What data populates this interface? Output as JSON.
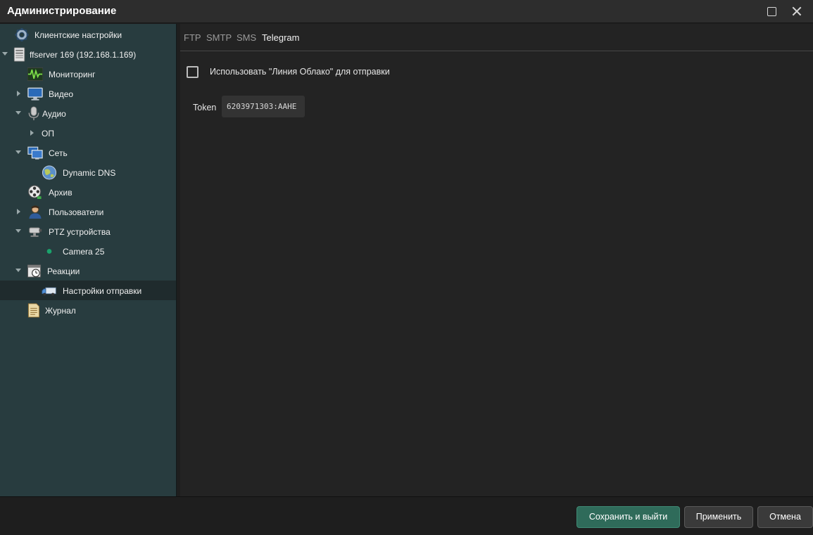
{
  "window": {
    "title": "Администрирование"
  },
  "sidebar": {
    "items": [
      {
        "label": "Клиентские настройки",
        "icon": "gear-icon"
      },
      {
        "label": "ffserver 169 (192.168.1.169)",
        "icon": "server-icon",
        "expanded": true
      },
      {
        "label": "Мониторинг",
        "icon": "monitoring-wave-icon"
      },
      {
        "label": "Видео",
        "icon": "monitor-icon",
        "expanded": false
      },
      {
        "label": "Аудио",
        "icon": "microphone-icon",
        "expanded": true
      },
      {
        "label": "ОП",
        "expanded": false
      },
      {
        "label": "Сеть",
        "icon": "network-icon",
        "expanded": true
      },
      {
        "label": "Dynamic DNS",
        "icon": "globe-icon"
      },
      {
        "label": "Архив",
        "icon": "film-reel-icon"
      },
      {
        "label": "Пользователи",
        "icon": "user-icon",
        "expanded": false
      },
      {
        "label": "PTZ устройства",
        "icon": "ptz-camera-icon",
        "expanded": true
      },
      {
        "label": "Camera 25",
        "icon": "status-dot-icon",
        "status_color": "#1aa36c"
      },
      {
        "label": "Реакции",
        "icon": "calendar-clock-icon",
        "expanded": true
      },
      {
        "label": "Настройки отправки",
        "icon": "delivery-truck-icon",
        "selected": true
      },
      {
        "label": "Журнал",
        "icon": "journal-icon"
      }
    ]
  },
  "tabs": [
    {
      "label": "FTP"
    },
    {
      "label": "SMTP"
    },
    {
      "label": "SMS"
    },
    {
      "label": "Telegram",
      "active": true
    }
  ],
  "form": {
    "use_cloud_label": "Использовать \"Линия Облако\" для отправки",
    "use_cloud_checked": false,
    "token_label": "Token",
    "token_value": "6203971303:AAHE"
  },
  "buttons": {
    "save_exit": "Сохранить и выйти",
    "apply": "Применить",
    "cancel": "Отмена"
  },
  "colors": {
    "sidebar_bg": "#283c3f",
    "content_bg": "#232323",
    "accent_green": "#2f6b5a",
    "status_green": "#1aa36c"
  }
}
